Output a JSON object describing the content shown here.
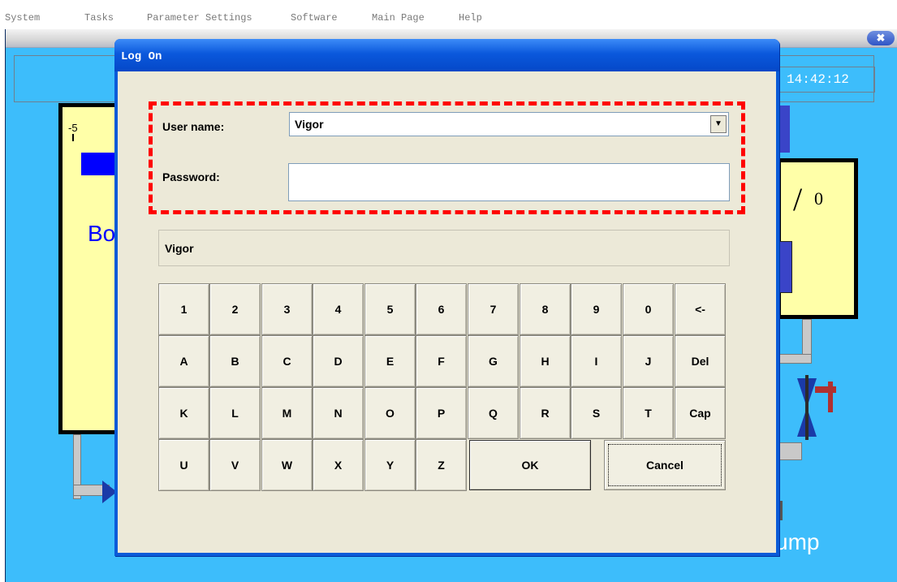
{
  "menu": [
    "System",
    "Tasks",
    "Parameter Settings",
    "Software",
    "Main Page",
    "Help"
  ],
  "background": {
    "clock": "14:42:12",
    "scale_label": "-5",
    "left_text": "Bo",
    "right_value": "0",
    "right_text": "ump",
    "close_symbol": "✖"
  },
  "dialog": {
    "title": "Log On",
    "user_label": "User name:",
    "user_value": "Vigor",
    "password_label": "Password:",
    "password_value": "",
    "display_value": "Vigor",
    "dropdown_icon": "▼"
  },
  "keypad": {
    "row1": [
      "1",
      "2",
      "3",
      "4",
      "5",
      "6",
      "7",
      "8",
      "9",
      "0",
      "<-"
    ],
    "row2": [
      "A",
      "B",
      "C",
      "D",
      "E",
      "F",
      "G",
      "H",
      "I",
      "J",
      "Del"
    ],
    "row3": [
      "K",
      "L",
      "M",
      "N",
      "O",
      "P",
      "Q",
      "R",
      "S",
      "T",
      "Cap"
    ],
    "row4": [
      "U",
      "V",
      "W",
      "X",
      "Y",
      "Z"
    ],
    "ok_label": "OK",
    "cancel_label": "Cancel"
  },
  "colors": {
    "background": "#3dbdfb",
    "dialog_title": "#0a58dc",
    "highlight": "#ff0000"
  }
}
